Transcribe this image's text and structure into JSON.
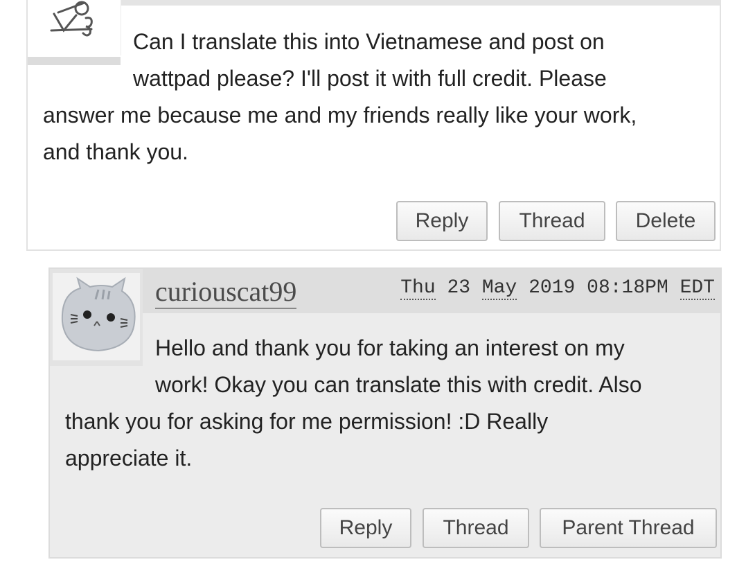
{
  "comment1": {
    "text_line1": "Can I translate this into Vietnamese and post on",
    "text_line2": "wattpad please? I'll post it with full credit. Please",
    "text_line3": "answer me because me and my friends really like your work,",
    "text_line4": "and thank you.",
    "buttons": {
      "reply": "Reply",
      "thread": "Thread",
      "delete": "Delete"
    }
  },
  "comment2": {
    "username": "curiouscat99",
    "date": {
      "day": "Thu",
      "daynum": "23",
      "month": "May",
      "year": "2019",
      "time": "08:18PM",
      "tz": "EDT"
    },
    "text_line1": "Hello and thank you for taking an interest on my",
    "text_line2": "work! Okay you can translate this with credit. Also",
    "text_line3": "thank you for asking for me permission! :D Really",
    "text_line4": "appreciate it.",
    "buttons": {
      "reply": "Reply",
      "thread": "Thread",
      "parent_thread": "Parent Thread"
    }
  },
  "icons": {
    "avatar1": "sketch-avatar-icon",
    "avatar2": "cat-avatar-icon"
  },
  "colors": {
    "reply_bg": "#ececec",
    "header_bg": "#dedede",
    "button_border": "#bdbdbd"
  }
}
